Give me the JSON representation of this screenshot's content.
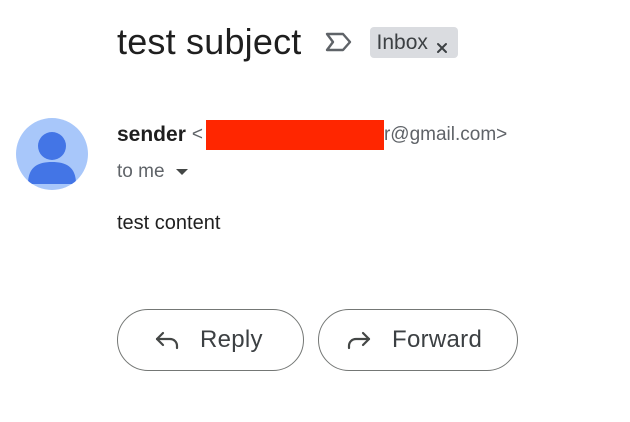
{
  "message": {
    "subject": "test subject",
    "label": "Inbox",
    "sender_name": "sender",
    "sender_email_open": "<",
    "sender_email_tail": "r@gmail.com>",
    "recipients": "to me",
    "body": "test content"
  },
  "actions": {
    "reply_label": "Reply",
    "forward_label": "Forward"
  },
  "icons": {
    "important": "importance-marker-icon",
    "label_remove": "close-icon",
    "avatar": "person-icon",
    "recipients_toggle": "caret-down-icon",
    "reply": "reply-arrow-icon",
    "forward": "forward-arrow-icon"
  },
  "colors": {
    "avatar_bg": "#a8c7fa",
    "avatar_fg": "#4375e6",
    "chip_bg": "#dadce0",
    "redaction": "#ff2600",
    "button_border": "#747775"
  }
}
